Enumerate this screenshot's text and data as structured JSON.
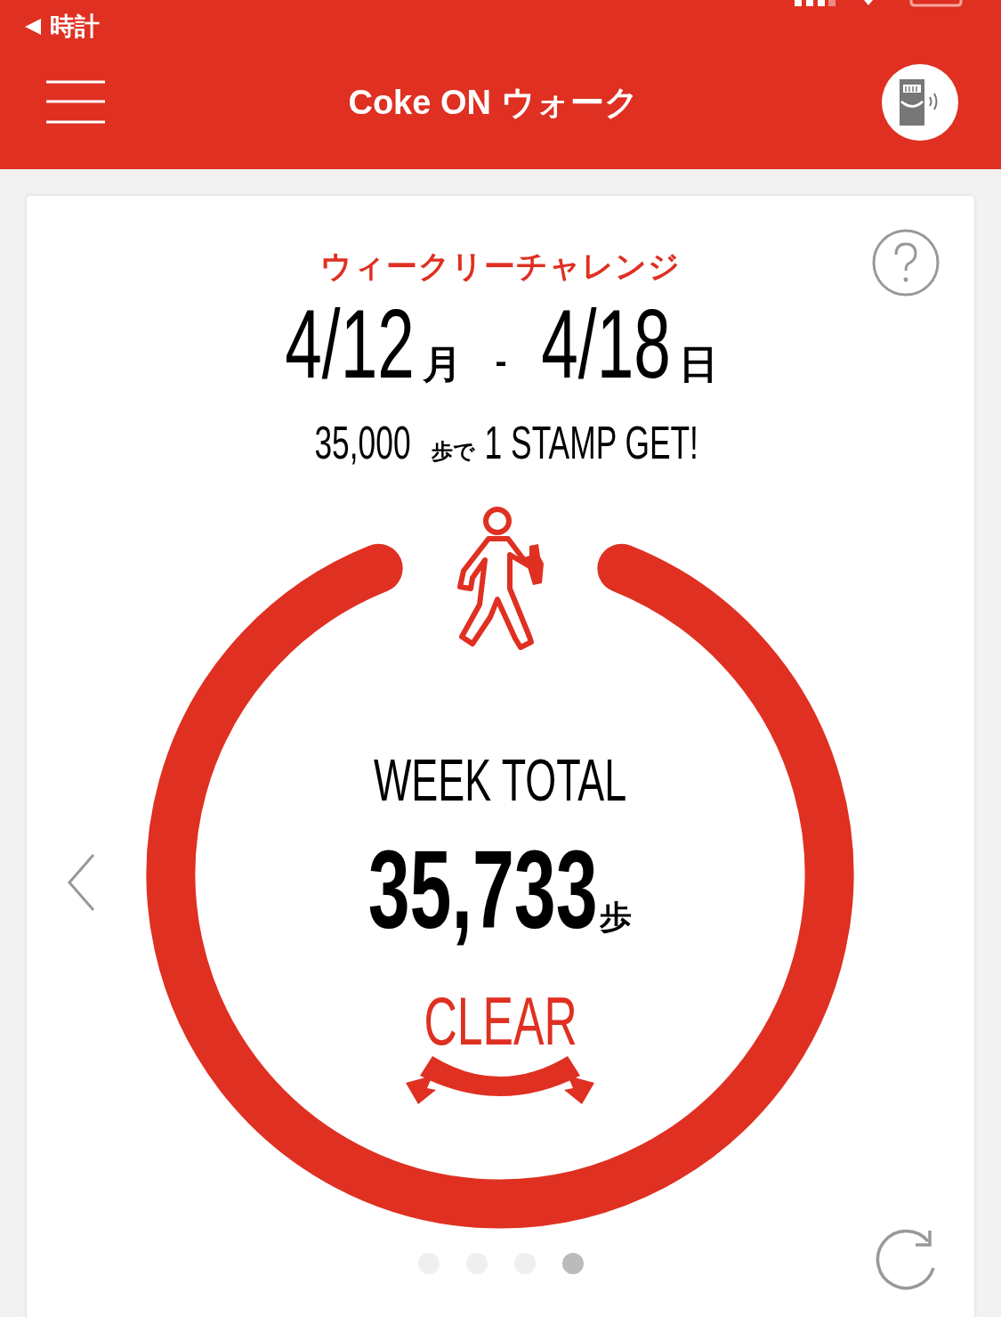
{
  "status_bar": {
    "back_label": "時計"
  },
  "header": {
    "title": "Coke ON ウォーク"
  },
  "challenge": {
    "title": "ウィークリーチャレンジ",
    "start": {
      "date": "4/12",
      "weekday": "月"
    },
    "separator": "-",
    "end": {
      "date": "4/18",
      "weekday": "日"
    },
    "goal": {
      "steps": "35,000",
      "unit": "歩で",
      "reward": "1 STAMP GET!"
    }
  },
  "total": {
    "label": "WEEK TOTAL",
    "value": "35,733",
    "unit": "歩",
    "cleared": true,
    "badge": "CLEAR"
  },
  "pages": [
    {
      "selected": false
    },
    {
      "selected": false
    },
    {
      "selected": false
    },
    {
      "selected": true
    }
  ]
}
